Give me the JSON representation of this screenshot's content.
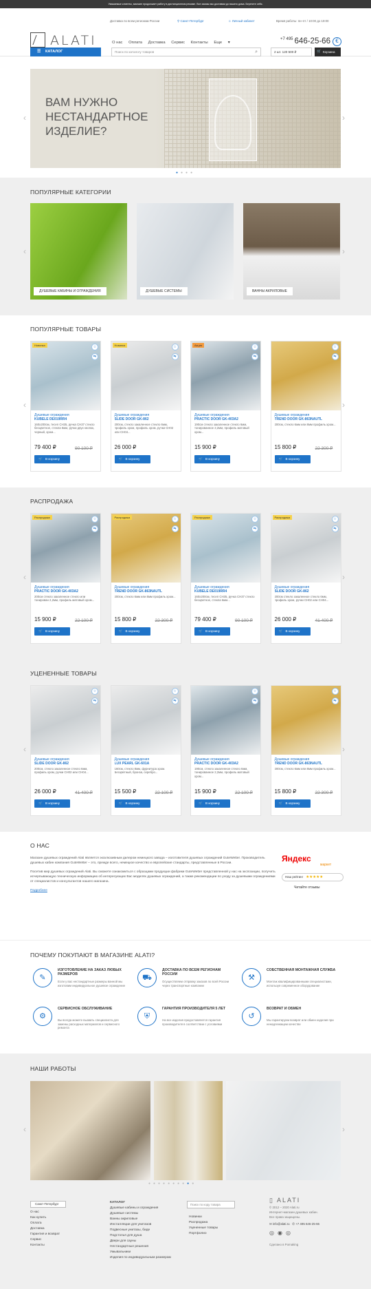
{
  "topbar": {
    "notice": "Уважаемые клиенты, магазин продолжает работу в дистанционном режиме. Все заказы мы доставим до вашего дома. Берегите себя."
  },
  "header": {
    "delivery": "Доставка по всем регионам России",
    "city": "Санкт-Петербург",
    "account": "Личный кабинет",
    "hours": "Время работы: пн–пт / 10:00 до 19:00",
    "logo_text": "ALATI",
    "phone_code": "+7 495",
    "phone": "646-25-66",
    "nav": [
      "О нас",
      "Оплата",
      "Доставка",
      "Сервис",
      "Контакты",
      "Еще"
    ],
    "catalog_button": "КАТАЛОГ",
    "search_placeholder": "Поиск по каталогу товаров",
    "cart_sum": "2 шт. 120 500 ₽",
    "cart_button": "Корзина"
  },
  "slider": {
    "headline": "ВАМ НУЖНО НЕСТАНДАРТНОЕ ИЗДЕЛИЕ?"
  },
  "popular_categories": {
    "title": "ПОПУЛЯРНЫЕ КАТЕГОРИИ",
    "items": [
      {
        "label": "ДУШЕВЫЕ КАБИНЫ И ОГРАЖДЕНИЯ"
      },
      {
        "label": "ДУШЕВЫЕ СИСТЕМЫ"
      },
      {
        "label": "ВАННЫ АКРИЛОВЫЕ"
      }
    ]
  },
  "add_to_cart": "В корзину",
  "popular_products": {
    "title": "ПОПУЛЯРНЫЕ ТОВАРЫ",
    "items": [
      {
        "badge": "Новинка",
        "category": "Душевые ограждения",
        "name": "KUBELE DE019RR4",
        "desc": "160x200см, тесеп CH35, ручка CH37 стекло бесцветное, стекла 6мм, ручки двух кнопок, черный, хром...",
        "price": "79 400 ₽",
        "old": "90 100 ₽"
      },
      {
        "badge": "Новинка",
        "category": "Душевые ограждения",
        "name": "SLIDE DOOR GK-862",
        "desc": "200см, стекло закаленное стекло 6мм, профиль хром, профиль хром, ручки CH02 или CH04...",
        "price": "26 000 ₽",
        "old": ""
      },
      {
        "badge": "Акция",
        "category": "Душевые ограждения",
        "name": "PRACTIC DOOR GK-403A2",
        "desc": "190см стекло закаленное стекло 6мм, тонированное 2,2мм, профиль матовый хром...",
        "price": "15 900 ₽",
        "old": ""
      },
      {
        "badge": "",
        "category": "Душевые ограждения",
        "name": "TREND DOOR GK-863NAUTL",
        "desc": "200см, стекло 6мм или 8мм профиль хром...",
        "price": "15 800 ₽",
        "old": "22 300 ₽"
      }
    ]
  },
  "sale": {
    "title": "РАСПРОДАЖА",
    "items": [
      {
        "badge": "Распродажа",
        "category": "Душевые ограждения",
        "name": "PRACTIC DOOR GK-403A2",
        "desc": "200см стекло закаленное стекло или тонирован 2,2мм, профиль матовый хром...",
        "price": "15 900 ₽",
        "old": "22 100 ₽"
      },
      {
        "badge": "Распродажа",
        "category": "Душевые ограждения",
        "name": "TREND DOOR GK-863NAUTL",
        "desc": "200см, стекло 6мм или 8мм профиль хром...",
        "price": "15 800 ₽",
        "old": "22 300 ₽"
      },
      {
        "badge": "Распродажа",
        "category": "Душевые ограждения",
        "name": "KUBELE DE019RR4",
        "desc": "160x200см, тесеп CH35, ручка CH37 стекло бесцветное, стекла 6мм...",
        "price": "79 400 ₽",
        "old": "90 100 ₽"
      },
      {
        "badge": "Распродажа",
        "category": "Душевые ограждения",
        "name": "SLIDE DOOR GK-862",
        "desc": "200см стекло закаленное стекло 6мм, профиль хром, ручки CH02 или CH04...",
        "price": "26 000 ₽",
        "old": "41 400 ₽"
      }
    ]
  },
  "discounted": {
    "title": "УЦЕНЕННЫЕ ТОВАРЫ",
    "items": [
      {
        "badge": "",
        "category": "Душевые ограждения",
        "name": "SLIDE DOOR GK-862",
        "desc": "200см, стекло закаленное стекло 6мм, профиль хром, ручки CH02 или CH04...",
        "price": "26 000 ₽",
        "old": "41 400 ₽"
      },
      {
        "badge": "",
        "category": "Душевые ограждения",
        "name": "LUX PEARL GK-601A",
        "desc": "160см, стекло 8мм, фурнитура хром. Бесцветный, бронза, серебро...",
        "price": "15 500 ₽",
        "old": "22 100 ₽"
      },
      {
        "badge": "",
        "category": "Душевые ограждения",
        "name": "PRACTIC DOOR GK-403A2",
        "desc": "190см, стекло закаленное стекло 6мм, тонированное 2,2мм, профиль матовый хром...",
        "price": "15 900 ₽",
        "old": "22 100 ₽"
      },
      {
        "badge": "",
        "category": "Душевые ограждения",
        "name": "TREND DOOR GK-863NAUTL",
        "desc": "200см, стекло 6мм или 8мм профиль хром...",
        "price": "15 800 ₽",
        "old": "22 300 ₽"
      }
    ]
  },
  "about": {
    "title": "О НАС",
    "p1": "Магазин душевых ограждений Alati является эксклюзивным дилером немецкого завода – изготовителя душевых ограждений GuteWetter. Производитель душевых кабин компания GuteWetter – это, прежде всего, немецкое качество и европейские стандарты, представленные в России.",
    "p2": "Посетив мир душевых ограждений Alati. Вы сможете ознакомиться с образцами продукции фабрики GuteWetter представленной у нас на экспозиции, получить исчерпывающую техническую информацию об интересующих Вас моделях душевых ограждений, а также рекомендации по уходу за душевыми ограждениями от специалистов и консультантов нашего магазина.",
    "more": "Подробнее",
    "yandex": "Яндекс",
    "market": "маркет",
    "rating": "Наш рейтинг",
    "reviews": "Читайте отзывы"
  },
  "why": {
    "title": "ПОЧЕМУ ПОКУПАЮТ В МАГАЗИНЕ ALATI?",
    "items": [
      {
        "title": "ИЗГОТОВЛЕНИЕ НА ЗАКАЗ ЛЮБЫХ РАЗМЕРОВ",
        "desc": "Если у вас нестандартные размеры ванной мы изготовим индивидуальное душевое ограждение"
      },
      {
        "title": "ДОСТАВКА ПО ВСЕМ РЕГИОНАМ РОССИИ",
        "desc": "Осуществляем отправку заказов по всей России через транспортные компании"
      },
      {
        "title": "СОБСТВЕННАЯ МОНТАЖНАЯ СЛУЖБА",
        "desc": "Монтаж квалифицированными специалистами, используя современное оборудование"
      },
      {
        "title": "СЕРВИСНОЕ ОБСЛУЖИВАНИЕ",
        "desc": "Вы всегда можете вызвать специалиста для замены расходных материалов и сервисного ремонта"
      },
      {
        "title": "ГАРАНТИЯ ПРОИЗВОДИТЕЛЯ 5 ЛЕТ",
        "desc": "На все изделия предоставляется гарантия производителя в соответствии с условиями"
      },
      {
        "title": "ВОЗВРАТ И ОБМЕН",
        "desc": "Мы гарантируем возврат или обмен изделия при ненадлежащем качестве"
      }
    ]
  },
  "works": {
    "title": "НАШИ РАБОТЫ"
  },
  "footer": {
    "city": "Санкт-Петербург",
    "col1": [
      "О нас",
      "Как купить",
      "Оплата",
      "Доставка",
      "Гарантия и возврат",
      "Сервис",
      "Контакты"
    ],
    "catalog_title": "КАТАЛОГ",
    "col2": [
      "Душевые кабины и ограждения",
      "Душевые системы",
      "Ванны акриловые",
      "Инсталляции для унитазов",
      "Подвесные унитазы, биде",
      "Подстолья для душа",
      "Двери для сауны",
      "Нестандартные решения",
      "Умывальники",
      "Изделия по индивидуальным размерам"
    ],
    "search_placeholder": "Поиск по коду товара",
    "col3": [
      "Новинки",
      "Распродажа",
      "Уцененные товары",
      "Портфолио"
    ],
    "logo": "ALATI",
    "copyright": "© 2012 – 2020 Alati.ru",
    "desc1": "Интернет-магазин душевых кабин.",
    "desc2": "Все права защищены.",
    "email": "info@alati.ru",
    "phone": "+7 495 646-25-66",
    "made_by": "Сделано в Pomaking"
  }
}
